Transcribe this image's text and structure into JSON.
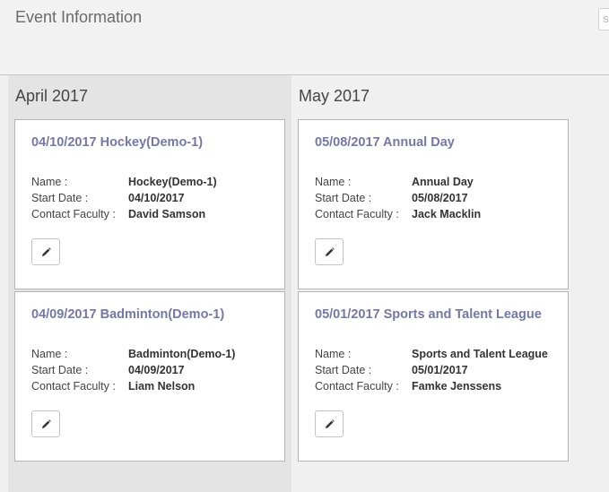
{
  "header": {
    "title": "Event Information",
    "search_placeholder": "S"
  },
  "columns": [
    {
      "title": "April 2017",
      "cards": [
        {
          "heading": "04/10/2017 Hockey(Demo-1)",
          "name_label": "Name :",
          "name": "Hockey(Demo-1)",
          "start_label": "Start Date :",
          "start_date": "04/10/2017",
          "faculty_label": "Contact Faculty :",
          "faculty": "David Samson",
          "edit_icon": "pencil-icon"
        },
        {
          "heading": "04/09/2017 Badminton(Demo-1)",
          "name_label": "Name :",
          "name": "Badminton(Demo-1)",
          "start_label": "Start Date :",
          "start_date": "04/09/2017",
          "faculty_label": "Contact Faculty :",
          "faculty": "Liam Nelson",
          "edit_icon": "pencil-icon"
        }
      ]
    },
    {
      "title": "May 2017",
      "cards": [
        {
          "heading": "05/08/2017 Annual Day",
          "name_label": "Name :",
          "name": "Annual Day",
          "start_label": "Start Date :",
          "start_date": "05/08/2017",
          "faculty_label": "Contact Faculty :",
          "faculty": "Jack Macklin",
          "edit_icon": "pencil-icon"
        },
        {
          "heading": "05/01/2017 Sports and Talent League",
          "name_label": "Name :",
          "name": "Sports and Talent League",
          "start_label": "Start Date :",
          "start_date": "05/01/2017",
          "faculty_label": "Contact Faculty :",
          "faculty": "Famke Jenssens",
          "edit_icon": "pencil-icon"
        }
      ]
    }
  ],
  "colors": {
    "card_title": "#7478a8",
    "april_column_bg": "#e4e4e4",
    "page_bg": "#f0f0f0"
  }
}
